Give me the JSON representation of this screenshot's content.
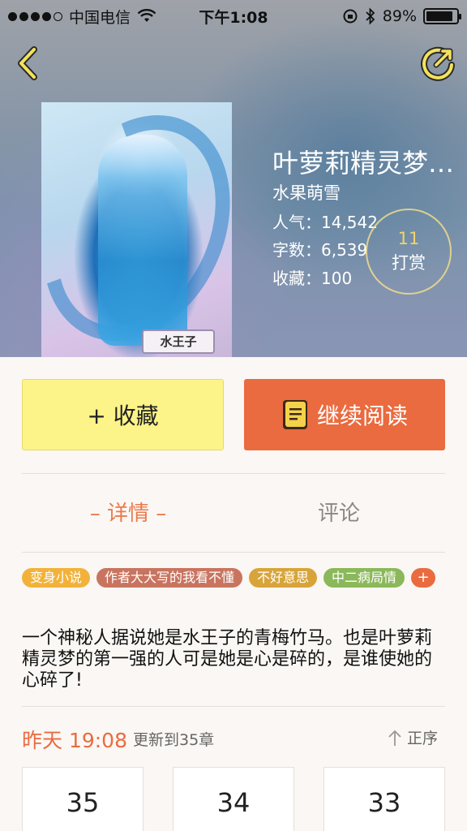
{
  "status_bar": {
    "carrier": "中国电信",
    "time": "下午1:08",
    "battery": "89%",
    "battery_level": 0.89
  },
  "nav": {
    "back_icon": "chevron-left-icon",
    "share_icon": "share-icon"
  },
  "book": {
    "title": "叶萝莉精灵梦…",
    "author": "水果萌雪",
    "popularity": "人气：14,542",
    "word_count": "字数：6,539",
    "favorites": "收藏：100",
    "cover_caption": "水王子",
    "tip_count": "11",
    "tip_label": "打赏"
  },
  "actions": {
    "favorite_label": "+ 收藏",
    "read_label": "继续阅读",
    "favorite_color": "#fcf488",
    "read_color": "#ea6b3f"
  },
  "tabs": {
    "detail": "– 详情 –",
    "comments": "评论"
  },
  "tags": [
    {
      "label": "变身小说",
      "color": "#f2b23a"
    },
    {
      "label": "作者大大写的我看不懂",
      "color": "#c9745f"
    },
    {
      "label": "不好意思",
      "color": "#d8a43a"
    },
    {
      "label": "中二病局情",
      "color": "#8bb85a"
    }
  ],
  "add_tag_label": "+",
  "description": "一个神秘人据说她是水王子的青梅竹马。也是叶萝莉精灵梦的第一强的人可是她是心是碎的，是谁使她的心碎了!",
  "update": {
    "time": "昨天 19:08",
    "note": "更新到35章",
    "sort_label": "正序"
  },
  "chapters": [
    "35",
    "34",
    "33"
  ]
}
